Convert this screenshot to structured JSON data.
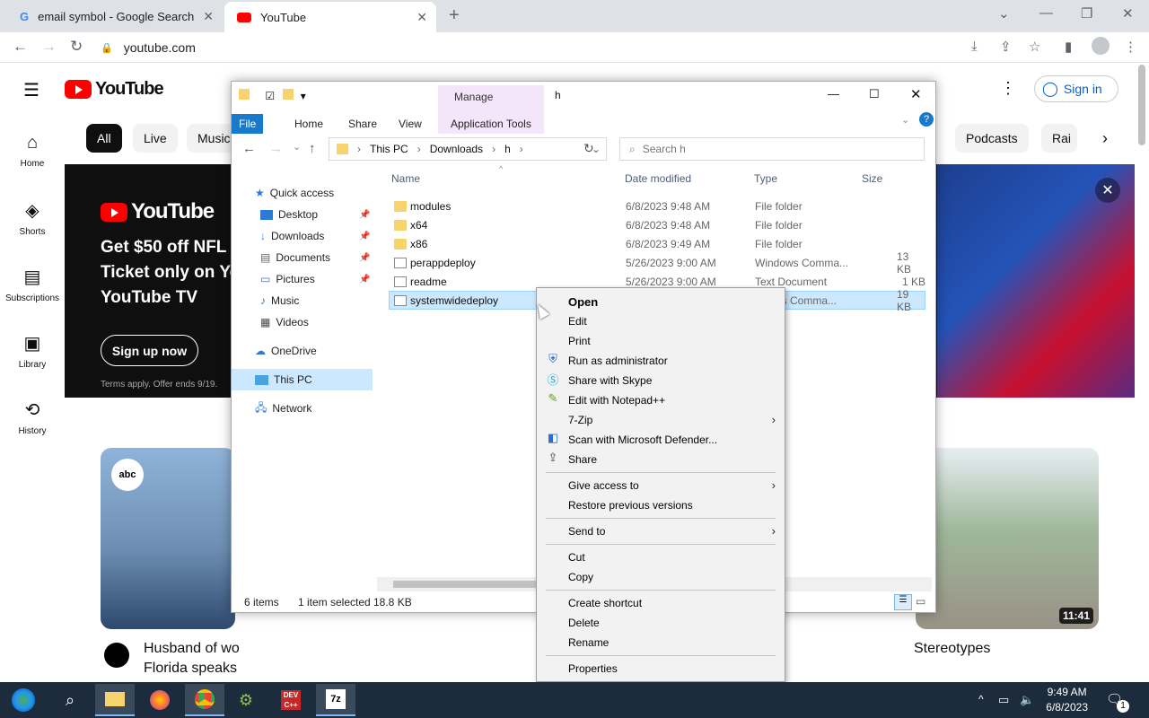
{
  "browser": {
    "tabs": [
      {
        "label": "email symbol - Google Search"
      },
      {
        "label": "YouTube"
      }
    ],
    "url": "youtube.com"
  },
  "youtube": {
    "logo": "YouTube",
    "sign_in": "Sign in",
    "rail": [
      {
        "label": "Home"
      },
      {
        "label": "Shorts"
      },
      {
        "label": "Subscriptions"
      },
      {
        "label": "Library"
      },
      {
        "label": "History"
      }
    ],
    "chips": [
      "All",
      "Live",
      "Music",
      "Podcasts",
      "Rai"
    ],
    "banner": {
      "logo": "YouTube",
      "line1": "Get $50 off NFL",
      "line2": "Ticket only on Yo",
      "line3": "YouTube TV",
      "cta": "Sign up now",
      "terms": "Terms apply. Offer ends 9/19."
    },
    "videos": [
      {
        "title_line1": "Husband of wo",
        "title_line2": "Florida speaks",
        "channel_badge": "abc NEWS"
      },
      {
        "title": "Stereotypes",
        "duration": "11:41"
      }
    ]
  },
  "explorer": {
    "title": "h",
    "manage_label": "Manage",
    "ribbon_tabs": [
      "File",
      "Home",
      "Share",
      "View",
      "Application Tools"
    ],
    "breadcrumb": [
      "This PC",
      "Downloads",
      "h"
    ],
    "search_placeholder": "Search h",
    "nav": [
      {
        "label": "Quick access"
      },
      {
        "label": "Desktop"
      },
      {
        "label": "Downloads"
      },
      {
        "label": "Documents"
      },
      {
        "label": "Pictures"
      },
      {
        "label": "Music"
      },
      {
        "label": "Videos"
      },
      {
        "label": "OneDrive"
      },
      {
        "label": "This PC"
      },
      {
        "label": "Network"
      }
    ],
    "columns": [
      "Name",
      "Date modified",
      "Type",
      "Size"
    ],
    "files": [
      {
        "name": "modules",
        "date": "6/8/2023 9:48 AM",
        "type": "File folder",
        "size": ""
      },
      {
        "name": "x64",
        "date": "6/8/2023 9:48 AM",
        "type": "File folder",
        "size": ""
      },
      {
        "name": "x86",
        "date": "6/8/2023 9:49 AM",
        "type": "File folder",
        "size": ""
      },
      {
        "name": "perappdeploy",
        "date": "5/26/2023 9:00 AM",
        "type": "Windows Comma...",
        "size": "13 KB"
      },
      {
        "name": "readme",
        "date": "5/26/2023 9:00 AM",
        "type": "Text Document",
        "size": "1 KB"
      },
      {
        "name": "systemwidedeploy",
        "date": "",
        "type": "ws Comma...",
        "size": "19 KB"
      }
    ],
    "status": {
      "items": "6 items",
      "selected": "1 item selected",
      "size": "18.8 KB"
    }
  },
  "context_menu": {
    "items": [
      "Open",
      "Edit",
      "Print",
      "Run as administrator",
      "Share with Skype",
      "Edit with Notepad++",
      "7-Zip",
      "Scan with Microsoft Defender...",
      "Share",
      "Give access to",
      "Restore previous versions",
      "Send to",
      "Cut",
      "Copy",
      "Create shortcut",
      "Delete",
      "Rename",
      "Properties"
    ]
  },
  "taskbar": {
    "time": "9:49 AM",
    "date": "6/8/2023",
    "notification_count": "1"
  }
}
